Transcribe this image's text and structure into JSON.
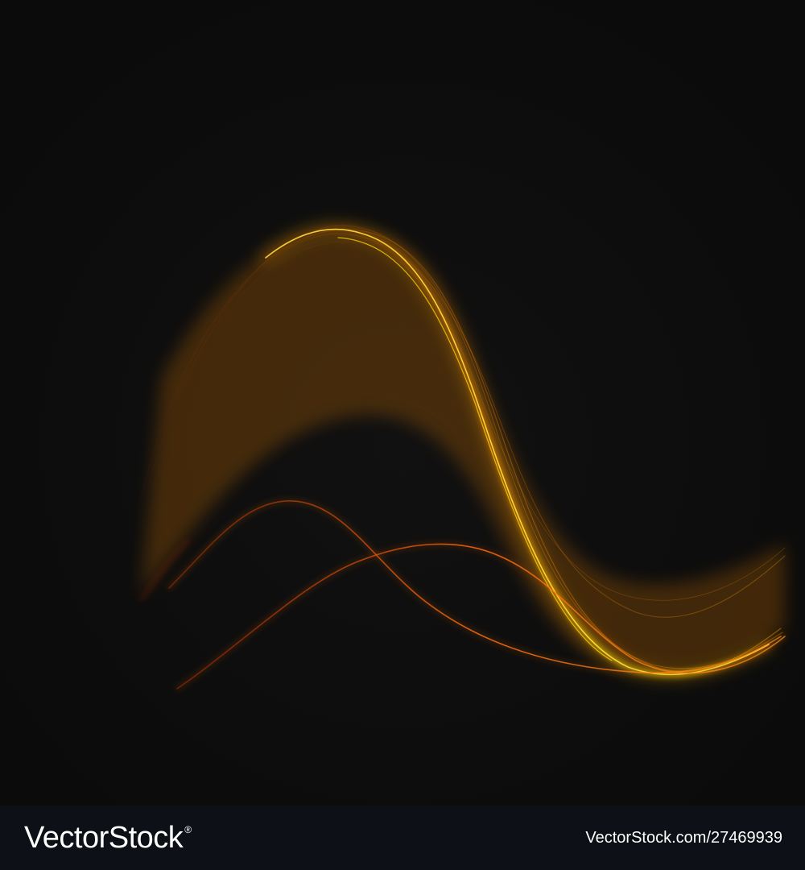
{
  "artwork": {
    "background_color": "#0c0c0c",
    "wave_colors": [
      "#ffd400",
      "#ff9a00",
      "#ff5a00",
      "#c83200"
    ]
  },
  "footer": {
    "brand": "VectorStock",
    "registered_mark": "®",
    "image_id": "VectorStock.com/27469939",
    "background_color": "#0e1017"
  }
}
